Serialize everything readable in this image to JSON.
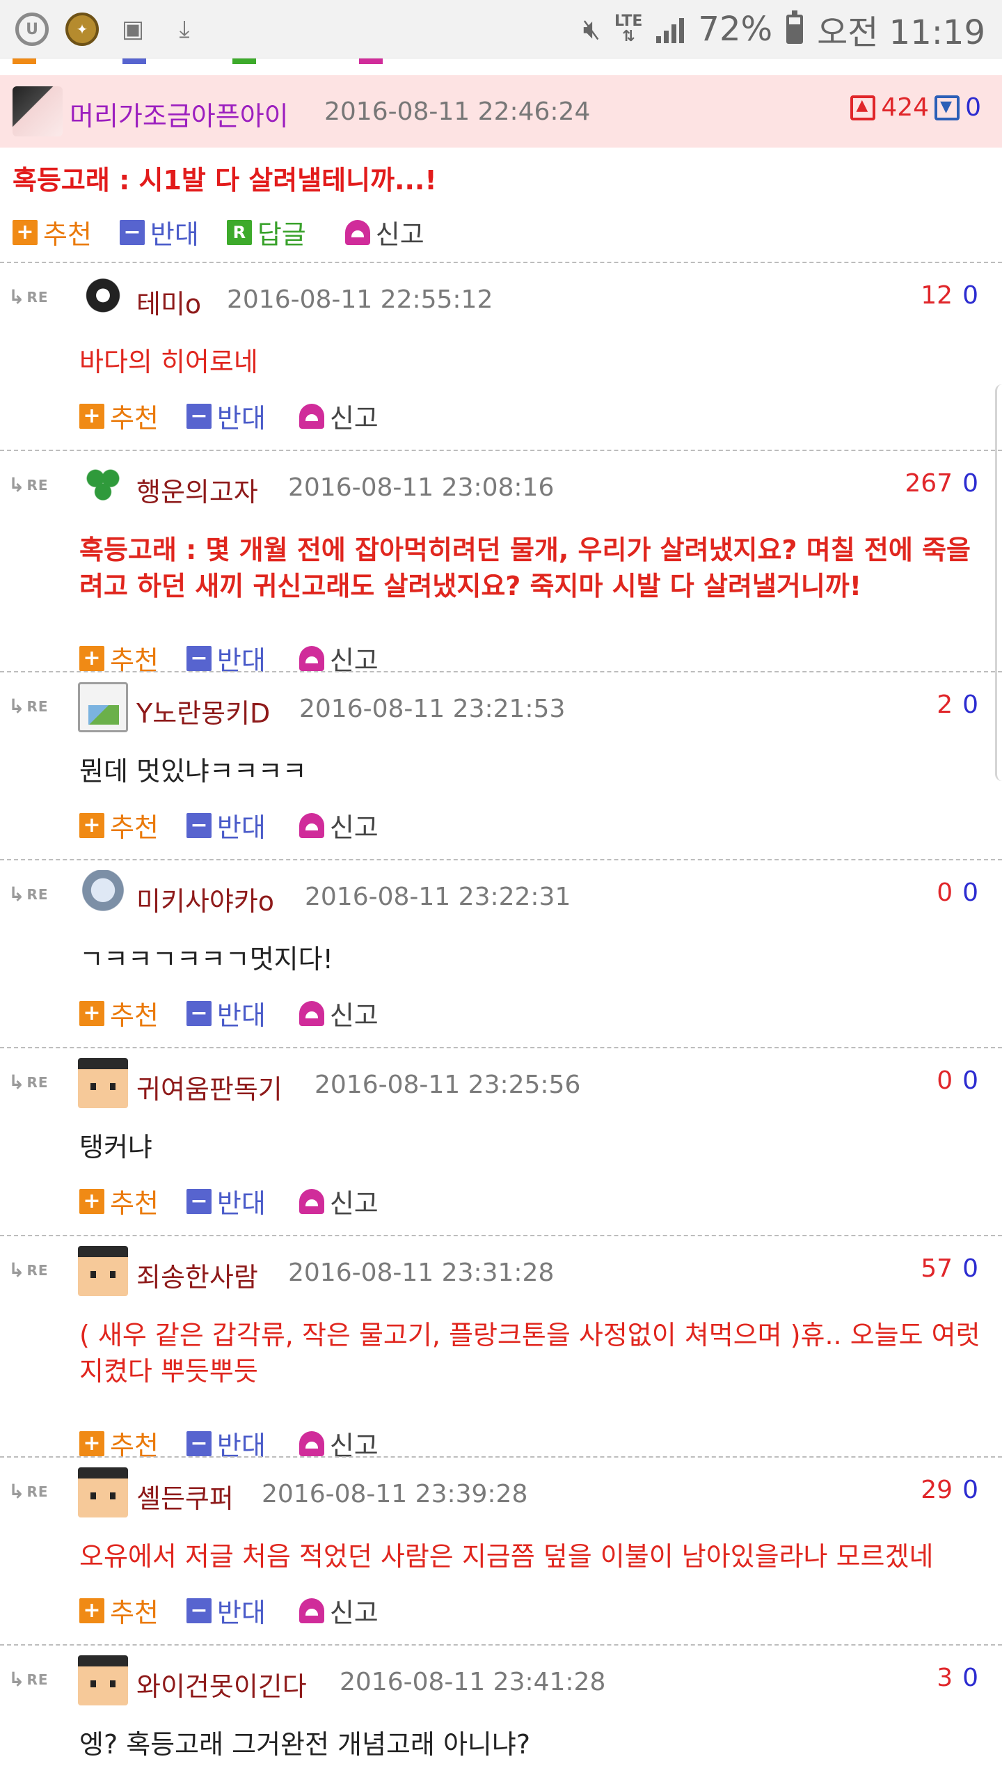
{
  "status_bar": {
    "battery_text": "72%",
    "battery_level": 0.72,
    "network": "LTE",
    "time": "오전 11:19",
    "icons": [
      "u-plus-icon",
      "badge-icon",
      "gallery-icon",
      "download-icon",
      "mute-icon",
      "signal-icon",
      "battery-icon"
    ]
  },
  "highlight_comment": {
    "author": "머리가조금아픈아이",
    "date": "2016-08-11 22:46:24",
    "up": "424",
    "down": "0",
    "text": "혹등고래 : 시1발 다 살려낼테니까...!",
    "actions": {
      "recommend": "추천",
      "oppose": "반대",
      "reply": "답글",
      "report": "신고"
    },
    "action_box_glyphs": {
      "recommend": "+",
      "oppose": "−",
      "reply": "R"
    }
  },
  "action_labels": {
    "recommend": "추천",
    "oppose": "반대",
    "report": "신고"
  },
  "re_label": "RE",
  "replies": [
    {
      "author": "테미o",
      "date": "2016-08-11 22:55:12",
      "up": "12",
      "down": "0",
      "text": "바다의 히어로네"
    },
    {
      "author": "행운의고자",
      "date": "2016-08-11 23:08:16",
      "up": "267",
      "down": "0",
      "text": "혹등고래 : 몇 개월 전에 잡아먹히려던 물개, 우리가 살려냈지요? 며칠 전에 죽을려고 하던 새끼 귀신고래도 살려냈지요? 죽지마 시발 다 살려낼거니까!"
    },
    {
      "author": "Y노란몽키D",
      "date": "2016-08-11 23:21:53",
      "up": "2",
      "down": "0",
      "text": "뭔데 멋있냐ㅋㅋㅋㅋ"
    },
    {
      "author": "미키사야카o",
      "date": "2016-08-11 23:22:31",
      "up": "0",
      "down": "0",
      "text": "ㄱㅋㅋㄱㅋㅋㄱ멋지다!"
    },
    {
      "author": "귀여움판독기",
      "date": "2016-08-11 23:25:56",
      "up": "0",
      "down": "0",
      "text": "탱커냐"
    },
    {
      "author": "죄송한사람",
      "date": "2016-08-11 23:31:28",
      "up": "57",
      "down": "0",
      "text": "( 새우 같은 갑각류, 작은 물고기, 플랑크톤을 사정없이 쳐먹으며 )휴.. 오늘도 여럿지켰다 뿌듯뿌듯"
    },
    {
      "author": "셸든쿠퍼",
      "date": "2016-08-11 23:39:28",
      "up": "29",
      "down": "0",
      "text": "오유에서 저글 처음 적었던 사람은 지금쯤 덮을 이불이 남아있을라나 모르겠네"
    },
    {
      "author": "와이건못이긴다",
      "date": "2016-08-11 23:41:28",
      "up": "3",
      "down": "0",
      "text": "엥? 혹등고래 그거완전 개념고래 아니냐?"
    }
  ]
}
